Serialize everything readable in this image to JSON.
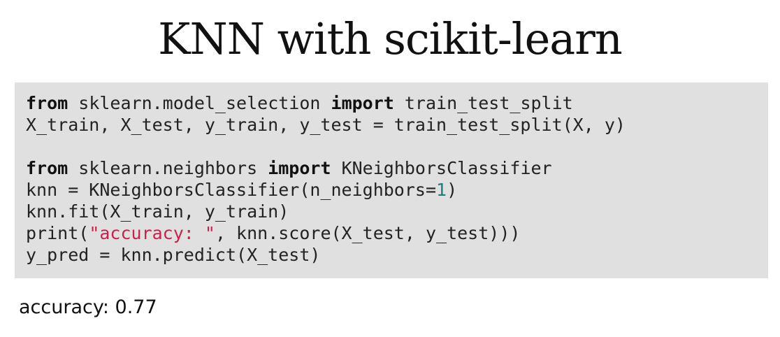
{
  "slide": {
    "title": "KNN with scikit-learn"
  },
  "code": {
    "line1": {
      "kw1": "from",
      "mod": " sklearn.model_selection ",
      "kw2": "import",
      "name": " train_test_split"
    },
    "line2": {
      "text": "X_train, X_test, y_train, y_test = train_test_split(X, y)"
    },
    "line4": {
      "kw1": "from",
      "mod": " sklearn.neighbors ",
      "kw2": "import",
      "name": " KNeighborsClassifier"
    },
    "line5": {
      "pre": "knn = KNeighborsClassifier(n_neighbors=",
      "num": "1",
      "post": ")"
    },
    "line6": {
      "text": "knn.fit(X_train, y_train)"
    },
    "line7": {
      "pre": "print(",
      "str": "\"accuracy: \"",
      "post": ", knn.score(X_test, y_test)))"
    },
    "line8": {
      "text": "y_pred = knn.predict(X_test)"
    }
  },
  "output": {
    "text": "accuracy: 0.77"
  },
  "colors": {
    "code_background": "#e0e0e0",
    "number": "#1a7f7f",
    "string": "#cc1f4d"
  }
}
